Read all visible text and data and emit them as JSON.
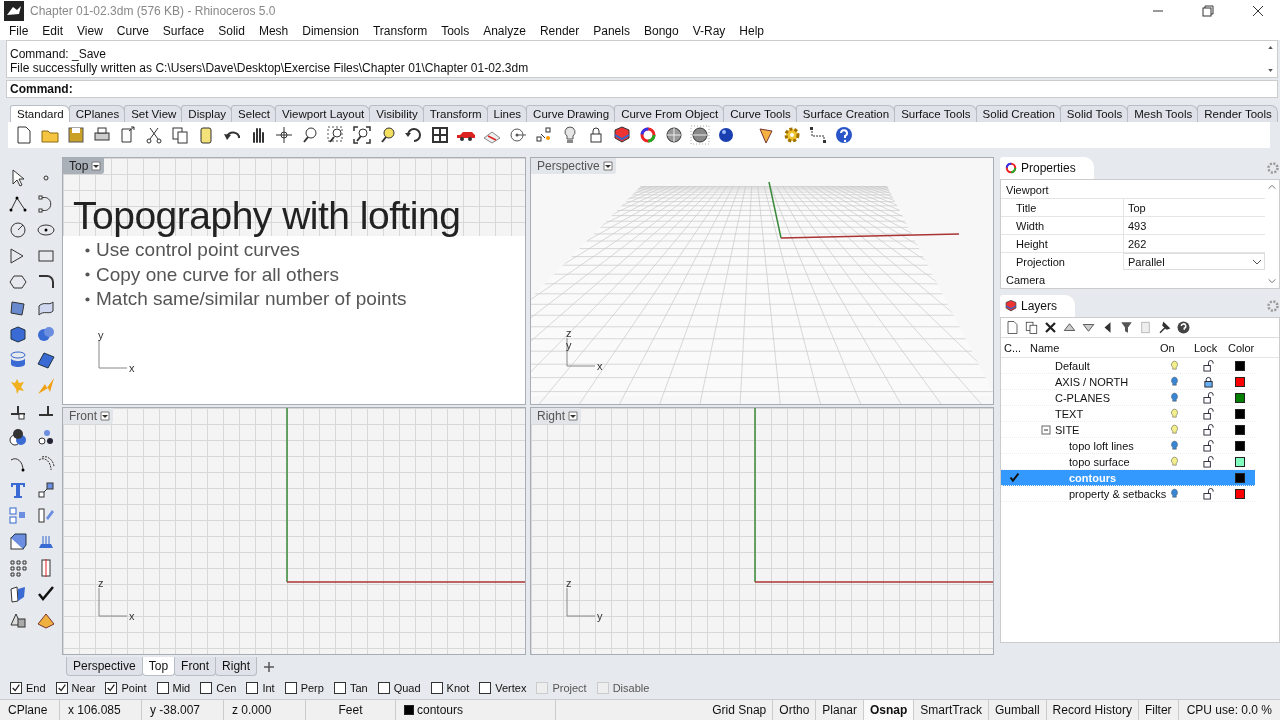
{
  "window": {
    "title": "Chapter 01-02.3dm (576 KB) - Rhinoceros 5.0"
  },
  "menu": [
    "File",
    "Edit",
    "View",
    "Curve",
    "Surface",
    "Solid",
    "Mesh",
    "Dimension",
    "Transform",
    "Tools",
    "Analyze",
    "Render",
    "Panels",
    "Bongo",
    "V-Ray",
    "Help"
  ],
  "command": {
    "history": [
      "Command: _Save",
      "File successfully written as C:\\Users\\Dave\\Desktop\\Exercise Files\\Chapter 01\\Chapter 01-02.3dm"
    ],
    "prompt": "Command:"
  },
  "toolbar_tabs": [
    {
      "label": "Standard",
      "selected": true
    },
    {
      "label": "CPlanes",
      "selected": false
    },
    {
      "label": "Set View",
      "selected": false
    },
    {
      "label": "Display",
      "selected": false
    },
    {
      "label": "Select",
      "selected": false
    },
    {
      "label": "Viewport Layout",
      "selected": false
    },
    {
      "label": "Visibility",
      "selected": false
    },
    {
      "label": "Transform",
      "selected": false
    },
    {
      "label": "Lines",
      "selected": false
    },
    {
      "label": "Curve Drawing",
      "selected": false
    },
    {
      "label": "Curve From Object",
      "selected": false
    },
    {
      "label": "Curve Tools",
      "selected": false
    },
    {
      "label": "Surface Creation",
      "selected": false
    },
    {
      "label": "Surface Tools",
      "selected": false
    },
    {
      "label": "Solid Creation",
      "selected": false
    },
    {
      "label": "Solid Tools",
      "selected": false
    },
    {
      "label": "Mesh Tools",
      "selected": false
    },
    {
      "label": "Render Tools",
      "selected": false
    }
  ],
  "viewports": [
    {
      "title": "Top",
      "active": true,
      "kind": "slide",
      "axes": {
        "vertical": "y",
        "horizontal": "x"
      },
      "slide": {
        "heading": "Topography with lofting",
        "bullets": [
          "Use control point curves",
          "Copy one curve for all others",
          "Match same/similar number of points"
        ]
      }
    },
    {
      "title": "Perspective",
      "active": false,
      "kind": "perspective",
      "axes": {
        "vertical": "z",
        "depth": "y",
        "horizontal": "x"
      }
    },
    {
      "title": "Front",
      "active": false,
      "kind": "plan",
      "axes": {
        "vertical": "z",
        "horizontal": "x"
      }
    },
    {
      "title": "Right",
      "active": false,
      "kind": "plan",
      "axes": {
        "vertical": "z",
        "horizontal": "y"
      }
    }
  ],
  "viewport_tabs": [
    {
      "label": "Perspective",
      "selected": false
    },
    {
      "label": "Top",
      "selected": true
    },
    {
      "label": "Front",
      "selected": false
    },
    {
      "label": "Right",
      "selected": false
    }
  ],
  "properties": {
    "title": "Properties",
    "section": "Viewport",
    "rows": [
      {
        "label": "Title",
        "value": "Top",
        "kind": "text"
      },
      {
        "label": "Width",
        "value": "493",
        "kind": "text"
      },
      {
        "label": "Height",
        "value": "262",
        "kind": "text"
      },
      {
        "label": "Projection",
        "value": "Parallel",
        "kind": "dropdown"
      }
    ],
    "next_section": "Camera"
  },
  "layers": {
    "title": "Layers",
    "columns": [
      "C...",
      "Name",
      "On",
      "Lock",
      "Color"
    ],
    "rows": [
      {
        "name": "Default",
        "current": false,
        "selected": false,
        "on": true,
        "locked": false,
        "color": "#000000"
      },
      {
        "name": "AXIS / NORTH",
        "current": false,
        "selected": false,
        "on": false,
        "locked": true,
        "color": "#ff0000"
      },
      {
        "name": "C-PLANES",
        "current": false,
        "selected": false,
        "on": false,
        "locked": false,
        "color": "#007f00"
      },
      {
        "name": "TEXT",
        "current": false,
        "selected": false,
        "on": true,
        "locked": false,
        "color": "#000000"
      },
      {
        "name": "SITE",
        "current": false,
        "selected": false,
        "on": true,
        "locked": false,
        "color": "#000000",
        "expanded": true,
        "children": [
          {
            "name": "topo loft lines",
            "current": false,
            "selected": false,
            "on": false,
            "locked": false,
            "color": "#000000"
          },
          {
            "name": "topo surface",
            "current": false,
            "selected": false,
            "on": true,
            "locked": false,
            "color": "#80ffc0"
          },
          {
            "name": "contours",
            "current": true,
            "selected": true,
            "color": "#000000"
          },
          {
            "name": "property & setbacks",
            "current": false,
            "selected": false,
            "on": false,
            "locked": false,
            "color": "#ff0000"
          }
        ]
      }
    ]
  },
  "osnaps": [
    {
      "label": "End",
      "checked": true,
      "disabled": false
    },
    {
      "label": "Near",
      "checked": true,
      "disabled": false
    },
    {
      "label": "Point",
      "checked": true,
      "disabled": false
    },
    {
      "label": "Mid",
      "checked": false,
      "disabled": false
    },
    {
      "label": "Cen",
      "checked": false,
      "disabled": false
    },
    {
      "label": "Int",
      "checked": false,
      "disabled": false
    },
    {
      "label": "Perp",
      "checked": false,
      "disabled": false
    },
    {
      "label": "Tan",
      "checked": false,
      "disabled": false
    },
    {
      "label": "Quad",
      "checked": false,
      "disabled": false
    },
    {
      "label": "Knot",
      "checked": false,
      "disabled": false
    },
    {
      "label": "Vertex",
      "checked": false,
      "disabled": false
    },
    {
      "label": "Project",
      "checked": false,
      "disabled": true
    },
    {
      "label": "Disable",
      "checked": false,
      "disabled": true
    }
  ],
  "status_bar": {
    "cplane": "CPlane",
    "x": "x 106.085",
    "y": "y -38.007",
    "z": "z 0.000",
    "units": "Feet",
    "layer": {
      "name": "contours",
      "color": "#000000"
    },
    "toggles": [
      {
        "label": "Grid Snap",
        "on": false
      },
      {
        "label": "Ortho",
        "on": false
      },
      {
        "label": "Planar",
        "on": false
      },
      {
        "label": "Osnap",
        "on": true
      },
      {
        "label": "SmartTrack",
        "on": false
      },
      {
        "label": "Gumball",
        "on": false
      },
      {
        "label": "Record History",
        "on": false
      },
      {
        "label": "Filter",
        "on": false
      }
    ],
    "cpu": "CPU use: 0.0 %"
  }
}
